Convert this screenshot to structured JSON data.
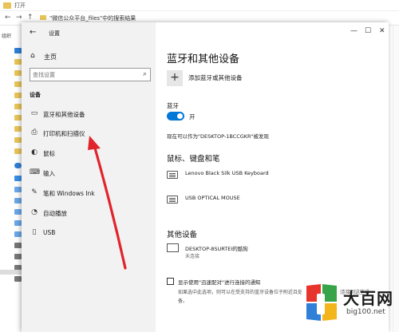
{
  "explorer": {
    "title": "打开",
    "path": "\"微信公众平台_files\"中的搜索结果",
    "nav_back": "←",
    "nav_forward": "→",
    "nav_up": "↑",
    "organize": "组织"
  },
  "settings": {
    "window_title": "设置",
    "back_icon": "←",
    "minimize": "—",
    "maximize": "☐",
    "close": "✕",
    "home_label": "主页",
    "home_icon": "⌂",
    "search_placeholder": "查找设置",
    "search_icon": "⌕",
    "section_label": "设备",
    "nav_items": [
      {
        "label": "蓝牙和其他设备",
        "icon": "▭"
      },
      {
        "label": "打印机和扫描仪",
        "icon": "⎙"
      },
      {
        "label": "鼠标",
        "icon": "◐"
      },
      {
        "label": "输入",
        "icon": "⌨"
      },
      {
        "label": "笔和 Windows Ink",
        "icon": "✎"
      },
      {
        "label": "自动播放",
        "icon": "◔"
      },
      {
        "label": "USB",
        "icon": "▯"
      }
    ],
    "content": {
      "title": "蓝牙和其他设备",
      "add_plus": "+",
      "add_label": "添加蓝牙或其他设备",
      "bluetooth_label": "蓝牙",
      "bluetooth_state": "开",
      "discoverable": "现在可以作为\"DESKTOP-1BCCGKR\"被发现",
      "mouse_keyboard_pen": "鼠标、键盘和笔",
      "devices": [
        {
          "name": "Lenovo Black Silk USB Keyboard"
        },
        {
          "name": "USB OPTICAL MOUSE"
        }
      ],
      "other_devices": "其他设备",
      "other_device": {
        "name": "DESKTOP-8SURTEI的酷狗",
        "status": "未连接"
      },
      "swift_pair_label": "显示使用\"迅速配对\"进行连接的通知",
      "swift_pair_desc": "如果选中此选项，则可以在受支持的蓝牙设备位于附近且处于配对模式时快速连接到这些设备。"
    }
  },
  "watermark": {
    "title": "大百网",
    "url": "big100.net"
  },
  "colors": {
    "accent": "#0078d7",
    "arrow": "#e0242b"
  }
}
